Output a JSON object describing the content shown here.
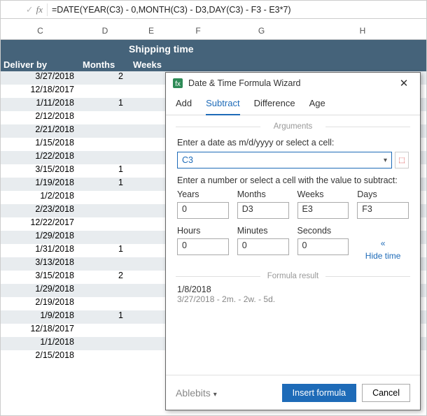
{
  "formula_bar": {
    "formula": "=DATE(YEAR(C3) - 0,MONTH(C3) - D3,DAY(C3) - F3 - E3*7)"
  },
  "columns": {
    "c": "C",
    "d": "D",
    "e": "E",
    "f": "F",
    "g": "G",
    "h": "H"
  },
  "sheet": {
    "title": "Shipping time",
    "headers": {
      "c": "Deliver by",
      "d": "Months",
      "e": "Weeks"
    },
    "rows": [
      {
        "date": "3/27/2018",
        "months": "2"
      },
      {
        "date": "12/18/2017",
        "months": ""
      },
      {
        "date": "1/11/2018",
        "months": "1"
      },
      {
        "date": "2/12/2018",
        "months": ""
      },
      {
        "date": "2/21/2018",
        "months": ""
      },
      {
        "date": "1/15/2018",
        "months": ""
      },
      {
        "date": "1/22/2018",
        "months": ""
      },
      {
        "date": "3/15/2018",
        "months": "1"
      },
      {
        "date": "1/19/2018",
        "months": "1"
      },
      {
        "date": "1/2/2018",
        "months": ""
      },
      {
        "date": "2/23/2018",
        "months": ""
      },
      {
        "date": "12/22/2017",
        "months": ""
      },
      {
        "date": "1/29/2018",
        "months": ""
      },
      {
        "date": "1/31/2018",
        "months": "1"
      },
      {
        "date": "3/13/2018",
        "months": ""
      },
      {
        "date": "3/15/2018",
        "months": "2"
      },
      {
        "date": "1/29/2018",
        "months": ""
      },
      {
        "date": "2/19/2018",
        "months": ""
      },
      {
        "date": "1/9/2018",
        "months": "1"
      },
      {
        "date": "12/18/2017",
        "months": ""
      },
      {
        "date": "1/1/2018",
        "months": ""
      },
      {
        "date": "2/15/2018",
        "months": ""
      }
    ]
  },
  "dialog": {
    "title": "Date & Time Formula Wizard",
    "tabs": {
      "add": "Add",
      "subtract": "Subtract",
      "difference": "Difference",
      "age": "Age"
    },
    "arguments_label": "Arguments",
    "enter_date_label": "Enter a date as m/d/yyyy or select a cell:",
    "cell_ref": "C3",
    "enter_number_label": "Enter a number or select a cell with the value to subtract:",
    "fields": {
      "years": {
        "label": "Years",
        "value": "0"
      },
      "months": {
        "label": "Months",
        "value": "D3"
      },
      "weeks": {
        "label": "Weeks",
        "value": "E3"
      },
      "days": {
        "label": "Days",
        "value": "F3"
      },
      "hours": {
        "label": "Hours",
        "value": "0"
      },
      "minutes": {
        "label": "Minutes",
        "value": "0"
      },
      "seconds": {
        "label": "Seconds",
        "value": "0"
      }
    },
    "hide_time": "Hide time",
    "result_label": "Formula result",
    "result_value": "1/8/2018",
    "result_detail": "3/27/2018 - 2m. - 2w. - 5d.",
    "brand": "Ablebits",
    "insert_btn": "Insert formula",
    "cancel_btn": "Cancel"
  }
}
